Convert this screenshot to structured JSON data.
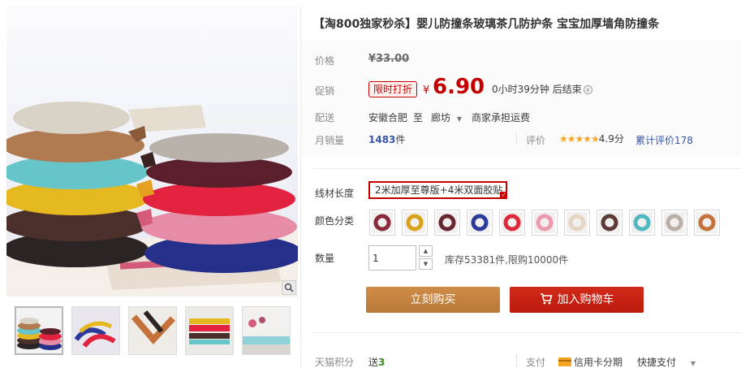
{
  "product": {
    "title": "【淘800独家秒杀】婴儿防撞条玻璃茶几防护条 宝宝加厚墙角防撞条"
  },
  "price": {
    "label": "价格",
    "currency": "¥",
    "original": "33.00"
  },
  "promo": {
    "label": "促销",
    "badge": "限时打折",
    "currency": "¥",
    "price": "6.90",
    "countdown": "0小时39分钟 后结束"
  },
  "shipping": {
    "label": "配送",
    "from": "安徽合肥",
    "to_word": "至",
    "destination": "廊坊",
    "fee_note": "商家承担运费"
  },
  "sales": {
    "label": "月销量",
    "count": "1483",
    "unit": "件",
    "rating_label": "评价",
    "stars": "★★★★★",
    "score": "4.9分",
    "total_reviews": "累计评价178"
  },
  "options": {
    "length_label": "线材长度",
    "length_value": "2米加厚至尊版+4米双面胶贴",
    "color_label": "颜色分类",
    "swatches": [
      {
        "color": "#8a2a3a",
        "name": "swatch-1"
      },
      {
        "color": "#d9a21b",
        "name": "swatch-2"
      },
      {
        "color": "#6b2630",
        "name": "swatch-3"
      },
      {
        "color": "#2b3a9b",
        "name": "swatch-4"
      },
      {
        "color": "#e0283c",
        "name": "swatch-5"
      },
      {
        "color": "#ee9aae",
        "name": "swatch-6"
      },
      {
        "color": "#e5d6c4",
        "name": "swatch-7"
      },
      {
        "color": "#5c3a35",
        "name": "swatch-8"
      },
      {
        "color": "#4fb8c0",
        "name": "swatch-9"
      },
      {
        "color": "#b8b0a8",
        "name": "swatch-10"
      },
      {
        "color": "#c4713b",
        "name": "swatch-11"
      }
    ]
  },
  "quantity": {
    "label": "数量",
    "value": "1",
    "stock_note": "库存53381件,限购10000件"
  },
  "actions": {
    "buy_now": "立刻购买",
    "add_to_cart": "加入购物车"
  },
  "footer": {
    "points_label": "天猫积分",
    "points_prefix": "送",
    "points_value": "3",
    "pay_label": "支付",
    "credit_card": "信用卡分期",
    "quick_pay": "快捷支付"
  },
  "colors": {
    "accent_red": "#c40000",
    "buy_orange": "#c08140",
    "cart_red": "#c61f12",
    "link_blue": "#3355aa"
  }
}
